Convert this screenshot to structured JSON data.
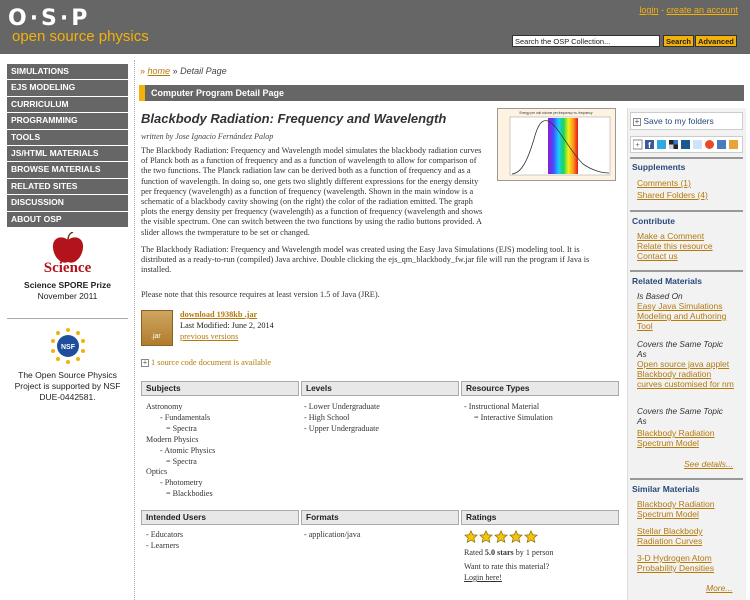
{
  "header": {
    "logo_top": "O·S·P",
    "logo_sub": "open source physics",
    "login": "login",
    "sep": " - ",
    "create_account": "create an account",
    "search_value": "Search the OSP Collection...",
    "search_btn": "Search",
    "advanced_btn": "Advanced"
  },
  "nav": {
    "items": [
      "SIMULATIONS",
      "EJS MODELING",
      "CURRICULUM",
      "PROGRAMMING",
      "TOOLS",
      "JS/HTML MATERIALS",
      "BROWSE MATERIALS",
      "RELATED SITES",
      "DISCUSSION",
      "ABOUT OSP"
    ],
    "science_word": "Science",
    "spore_title": "Science SPORE Prize",
    "spore_date": "November 2011",
    "nsf_badge": "NSF",
    "nsf_text": "The Open Source Physics Project is supported by NSF DUE-0442581."
  },
  "breadcrumb": {
    "arrow": "»",
    "home": "home",
    "current": "Detail Page"
  },
  "page_bar": "Computer Program Detail Page",
  "resource": {
    "title": "Blackbody Radiation: Frequency and Wavelength",
    "author": "written by Jose Ignacio Fernández Palop",
    "thumb_caption": "Energy per unit volume per frequency vs. frequency",
    "desc1": "The Blackbody Radiation: Frequency and Wavelength model simulates the blackbody radiation curves of Planck both as a function of frequency and as a function of wavelength to allow for comparison of the two functions. The Planck radiation law can be derived both as a function of frequency and as a function of wavelength. In doing so, one gets two slightly different expressions for the energy density per frequency (wavelength) as a function of frequency (wavelength. Shown in the main window is a schematic of a blackbody cavity showing (on the right) the color of the radiation emitted. The graph plots the energy density per frequency (wavelength) as a function of frequency (wavelength and shows the visible spectrum. One can switch between the two functions by using the radio buttons provided. A slider allows the twmperature to be set or changed.",
    "desc2": "The Blackbody Radiation: Frequency and Wavelength model was created using the Easy Java Simulations (EJS) modeling tool.  It is distributed as a ready-to-run (compiled) Java archive.  Double clicking the ejs_qm_blackbody_fw.jar file will run the program if Java is installed.",
    "desc3": "Please note that this resource requires at least version 1.5 of Java (JRE).",
    "jar_label": ".jar",
    "download": "download 1938kb .jar",
    "modified": "Last Modified: June 2, 2014",
    "previous_versions": "previous versions",
    "source_doc": "1 source code document is available"
  },
  "table1": {
    "headers": [
      "Subjects",
      "Levels",
      "Resource Types"
    ],
    "subjects": [
      "Astronomy",
      "- Fundamentals",
      "= Spectra",
      "Modern Physics",
      "- Atomic Physics",
      "= Spectra",
      "Optics",
      "- Photometry",
      "= Blackbodies"
    ],
    "levels": [
      "- Lower Undergraduate",
      "- High School",
      "- Upper Undergraduate"
    ],
    "types": [
      "- Instructional Material",
      "= Interactive Simulation"
    ]
  },
  "table2": {
    "headers": [
      "Intended Users",
      "Formats",
      "Ratings"
    ],
    "users": [
      "- Educators",
      "- Learners"
    ],
    "formats": [
      "- application/java"
    ],
    "rating_value": 5,
    "rated_pre": "Rated ",
    "rated_stars": "5.0 stars",
    "rated_post": " by 1 person",
    "want_rate": "Want to rate this material?",
    "login_here": "Login here!"
  },
  "sidebar": {
    "save": "Save to my folders",
    "supplements": "Supplements",
    "comments": "Comments (1)",
    "shared": "Shared Folders (4)",
    "contribute": "Contribute",
    "make_comment": "Make a Comment",
    "relate": "Relate this resource",
    "contact": "Contact us",
    "related": "Related Materials",
    "is_based_on": "Is Based On",
    "based_link": "Easy Java Simulations Modeling and Authoring Tool",
    "covers1": "Covers the Same Topic As",
    "covers1_link": "Open source java applet Blackbody radiation curves customised for nm",
    "covers2": "Covers the Same Topic As",
    "covers2_link": "Blackbody Radiation Spectrum Model",
    "see_details": "See details...",
    "similar": "Similar Materials",
    "similar_links": [
      "Blackbody Radiation Spectrum Model",
      "Stellar Blackbody Radiation Curves",
      "3-D Hydrogen Atom Probability Densities"
    ],
    "more": "More..."
  },
  "colors": {
    "accent": "#f3b10b",
    "header": "#666666",
    "link": "#b47a0c",
    "sidebar_head": "#2a4a7a"
  }
}
